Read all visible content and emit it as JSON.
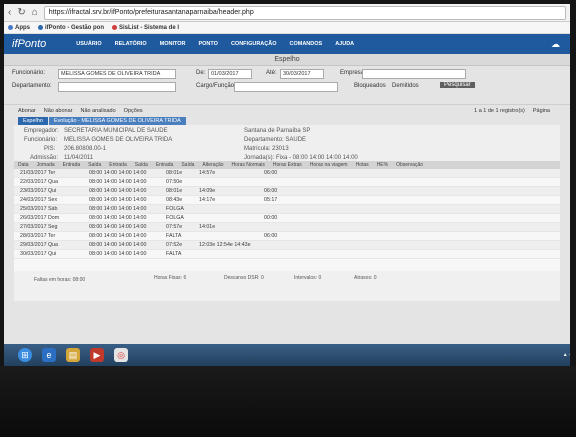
{
  "browser": {
    "url": "https://ifractal.srv.br/ifPonto/prefeiturasantanaparnaiba/header.php",
    "bookmarks": [
      "Apps",
      "ifPonto - Gestão pon",
      "SisList - Sistema de I"
    ]
  },
  "app": {
    "logo": "ifPonto",
    "menu": [
      "USUÁRIO",
      "RELATÓRIO",
      "MONITOR",
      "PONTO",
      "CONFIGURAÇÃO",
      "COMANDOS",
      "AJUDA"
    ],
    "page_title": "Espelho"
  },
  "filters": {
    "funcionario_label": "Funcionário:",
    "funcionario_value": "MELISSA GOMES DE OLIVEIRA TRIDA",
    "departamento_label": "Departamento:",
    "de_label": "De:",
    "de_value": "01/03/2017",
    "ate_label": "Até:",
    "ate_value": "30/03/2017",
    "empresa_label": "Empresa:",
    "cargo_label": "Cargo/Função:",
    "bloqueados": "Bloqueados",
    "demitidos": "Demitidos",
    "pesquisar": "Pesquisar"
  },
  "actions": {
    "abonar": "Abonar",
    "nao_abonar": "Não abonar",
    "nao_analisado": "Não analisado",
    "opcoes": "Opções",
    "paging": "1 a 1 de 1 registro(s)",
    "pagina_label": "Página"
  },
  "tabs": [
    "Espelho",
    "Evolução - MELISSA GOMES DE OLIVEIRA TRIDA"
  ],
  "info": {
    "empregador_label": "Empregador:",
    "empregador": "SECRETARIA MUNICIPAL DE SAUDE",
    "empresa": "Santana de Parnaíba SP",
    "funcionario_label": "Funcionário:",
    "funcionario": "MELISSA GOMES DE OLIVEIRA TRIDA",
    "departamento": "Departamento: SAUDE",
    "pis_label": "PIS:",
    "pis": "206.80808.00-1",
    "matricula": "Matrícula: 23013",
    "admissao_label": "Admissão:",
    "admissao": "11/04/2011",
    "jornada": "Jornada(s): Fixa - 08:00 14:00 14:00 14:00"
  },
  "grid": {
    "headers": [
      "Data",
      "Jornada",
      "Entrada",
      "Saída",
      "Entrada",
      "Saída",
      "Entrada",
      "Saída",
      "Alteração",
      "Horas Normais",
      "Horas Extras",
      "Horas na viagem",
      "Hotas",
      "HE%",
      "Observação"
    ],
    "rows": [
      {
        "d": "21/03/2017 Ter",
        "j": "08:00 14:00 14:00 14:00",
        "e": "08:01e",
        "s": "14:57e",
        "hn": "06:00"
      },
      {
        "d": "22/03/2017 Qua",
        "j": "08:00 14:00 14:00 14:00",
        "e": "07:50e",
        "s": "",
        "hn": ""
      },
      {
        "d": "23/03/2017 Qui",
        "j": "08:00 14:00 14:00 14:00",
        "e": "08:01e",
        "s": "14:09e",
        "hn": "06:00"
      },
      {
        "d": "24/03/2017 Sex",
        "j": "08:00 14:00 14:00 14:00",
        "e": "08:43e",
        "s": "14:17e",
        "hn": "05:17"
      },
      {
        "d": "25/03/2017 Sáb",
        "j": "08:00 14:00 14:00 14:00",
        "e": "FOLGA",
        "s": "",
        "hn": ""
      },
      {
        "d": "26/03/2017 Dom",
        "j": "08:00 14:00 14:00 14:00",
        "e": "FOLGA",
        "s": "",
        "hn": "00:00"
      },
      {
        "d": "27/03/2017 Seg",
        "j": "08:00 14:00 14:00 14:00",
        "e": "07:57e",
        "s": "14:01e",
        "hn": ""
      },
      {
        "d": "28/03/2017 Ter",
        "j": "08:00 14:00 14:00 14:00",
        "e": "FALTA",
        "s": "",
        "hn": "06:00"
      },
      {
        "d": "29/03/2017 Qua",
        "j": "08:00 14:00 14:00 14:00",
        "e": "07:52e",
        "s": "12:03e 12:54e 14:43e",
        "hn": ""
      },
      {
        "d": "30/03/2017 Qui",
        "j": "08:00 14:00 14:00 14:00",
        "e": "FALTA",
        "s": "",
        "hn": ""
      }
    ]
  },
  "summary": {
    "faltas": "Faltas em horas: 08:00",
    "horas_fixas": "Horas Fixas: 6",
    "descanso": "Descanso DSR: 0",
    "intervalos": "Intervalos: 0",
    "atrasos": "Atrasos: 0"
  },
  "colors": {
    "appbar": "#1f5a9f",
    "tab": "#2b67ad"
  }
}
